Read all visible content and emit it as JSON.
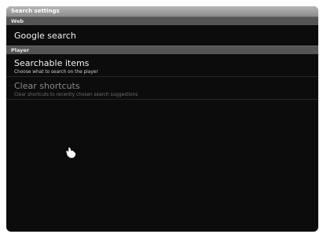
{
  "window": {
    "title": "Search settings"
  },
  "sections": [
    {
      "label": "Web"
    },
    {
      "label": "Player"
    }
  ],
  "items": {
    "google_search": {
      "title": "Google search"
    },
    "searchable_items": {
      "title": "Searchable items",
      "summary": "Choose what to search on the player"
    },
    "clear_shortcuts": {
      "title": "Clear shortcuts",
      "summary": "Clear shortcuts to recently chosen search suggestions",
      "enabled": false
    }
  },
  "colors": {
    "background": "#0c0c0c",
    "section": "#555555",
    "title_bar": "#9a9a9a"
  },
  "icons": {
    "pointer": "hand-cursor-icon"
  }
}
